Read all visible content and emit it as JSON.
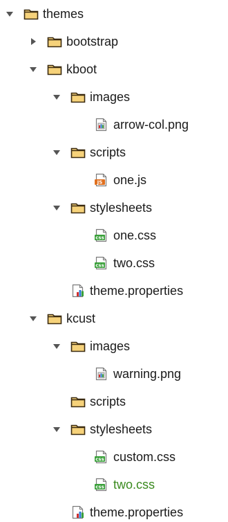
{
  "tree": {
    "rows": [
      {
        "label": "themes",
        "type": "folder",
        "expanded": true,
        "icon": "folder-icon",
        "depth": 0
      },
      {
        "label": "bootstrap",
        "type": "folder",
        "expanded": false,
        "icon": "folder-icon",
        "depth": 1
      },
      {
        "label": "kboot",
        "type": "folder",
        "expanded": true,
        "icon": "folder-icon",
        "depth": 1
      },
      {
        "label": "images",
        "type": "folder",
        "expanded": true,
        "icon": "folder-icon",
        "depth": 2
      },
      {
        "label": "arrow-col.png",
        "type": "file",
        "icon": "image-file-icon",
        "depth": 3
      },
      {
        "label": "scripts",
        "type": "folder",
        "expanded": true,
        "icon": "folder-icon",
        "depth": 2
      },
      {
        "label": "one.js",
        "type": "file",
        "icon": "js-file-icon",
        "depth": 3
      },
      {
        "label": "stylesheets",
        "type": "folder",
        "expanded": true,
        "icon": "folder-icon",
        "depth": 2
      },
      {
        "label": "one.css",
        "type": "file",
        "icon": "css-file-icon",
        "depth": 3
      },
      {
        "label": "two.css",
        "type": "file",
        "icon": "css-file-icon",
        "depth": 3
      },
      {
        "label": "theme.properties",
        "type": "file",
        "icon": "properties-file-icon",
        "depth": 2
      },
      {
        "label": "kcust",
        "type": "folder",
        "expanded": true,
        "icon": "folder-icon",
        "depth": 1
      },
      {
        "label": "images",
        "type": "folder",
        "expanded": true,
        "icon": "folder-icon",
        "depth": 2
      },
      {
        "label": "warning.png",
        "type": "file",
        "icon": "image-file-icon",
        "depth": 3
      },
      {
        "label": "scripts",
        "type": "folder",
        "expanded": false,
        "leafFolder": true,
        "icon": "folder-icon",
        "depth": 2
      },
      {
        "label": "stylesheets",
        "type": "folder",
        "expanded": true,
        "icon": "folder-icon",
        "depth": 2
      },
      {
        "label": "custom.css",
        "type": "file",
        "icon": "css-file-icon",
        "depth": 3
      },
      {
        "label": "two.css",
        "type": "file",
        "icon": "css-file-icon",
        "depth": 3,
        "modified": true
      },
      {
        "label": "theme.properties",
        "type": "file",
        "icon": "properties-file-icon",
        "depth": 2
      }
    ]
  },
  "colors": {
    "folder_fill": "#f6d27a",
    "folder_stroke": "#3a2a10",
    "arrow": "#555555",
    "modified_text": "#3a8a1e",
    "css_badge": "#3aa03a",
    "js_badge": "#e0701f"
  },
  "badges": {
    "css": "css",
    "js": "JS"
  }
}
